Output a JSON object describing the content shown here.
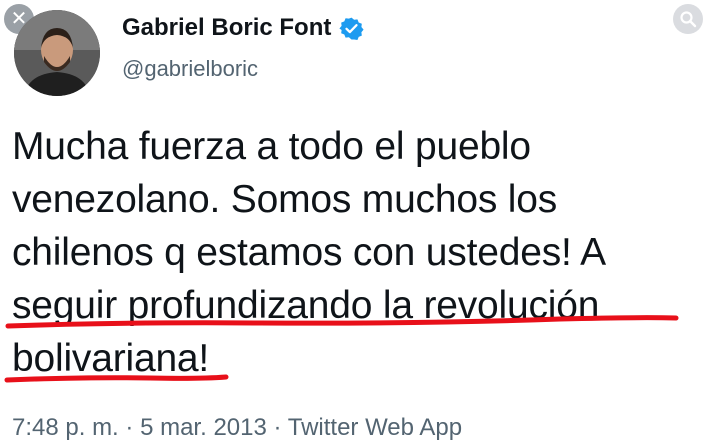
{
  "author": {
    "display_name": "Gabriel Boric Font",
    "handle": "@gabrielboric",
    "verified": true
  },
  "tweet": {
    "lines": [
      "Mucha fuerza a todo el pueblo",
      "venezolano. Somos muchos los",
      "chilenos q estamos con ustedes! A",
      "seguir profundizando la revolución",
      "bolivariana!"
    ],
    "timestamp": "7:48 p. m.",
    "date": "5 mar. 2013",
    "source": "Twitter Web App",
    "separator": "·"
  },
  "icons": {
    "close": "close-icon",
    "search": "lens-search-icon",
    "verified": "verified-badge-icon"
  },
  "colors": {
    "verified_blue": "#1d9bf0",
    "annotation_red": "#e8101a",
    "secondary_text": "#536471"
  }
}
